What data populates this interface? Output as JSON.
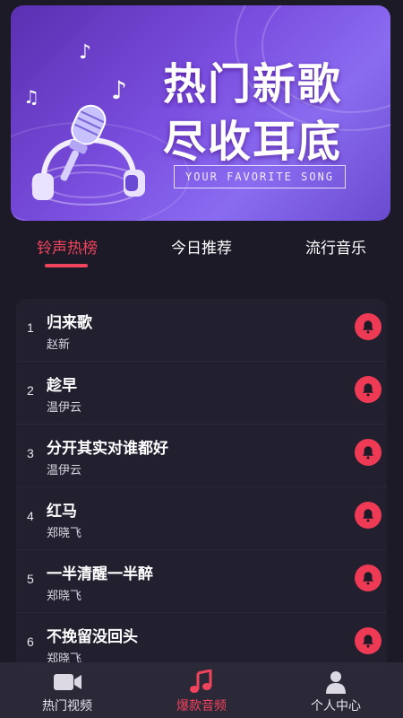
{
  "banner": {
    "title_line1": "热门新歌",
    "title_line2": "尽收耳底",
    "subtitle": "YOUR FAVORITE SONG",
    "icons": [
      "microphone-icon",
      "headphones-icon",
      "music-note-icon"
    ]
  },
  "tabs": [
    {
      "label": "铃声热榜",
      "active": true
    },
    {
      "label": "今日推荐",
      "active": false
    },
    {
      "label": "流行音乐",
      "active": false
    }
  ],
  "songs": [
    {
      "index": "1",
      "title": "归来歌",
      "artist": "赵新"
    },
    {
      "index": "2",
      "title": "趁早",
      "artist": "温伊云"
    },
    {
      "index": "3",
      "title": "分开其实对谁都好",
      "artist": "温伊云"
    },
    {
      "index": "4",
      "title": "红马",
      "artist": "郑晓飞"
    },
    {
      "index": "5",
      "title": "一半清醒一半醉",
      "artist": "郑晓飞"
    },
    {
      "index": "6",
      "title": "不挽留没回头",
      "artist": "郑晓飞"
    }
  ],
  "bottom_nav": [
    {
      "label": "热门视频",
      "icon": "video-camera-icon",
      "active": false
    },
    {
      "label": "爆款音频",
      "icon": "music-note-icon",
      "active": true
    },
    {
      "label": "个人中心",
      "icon": "person-icon",
      "active": false
    }
  ],
  "colors": {
    "accent": "#f0435c",
    "background": "#1d1a28",
    "list_bg": "#221f2f",
    "nav_bg": "#2b2837"
  }
}
